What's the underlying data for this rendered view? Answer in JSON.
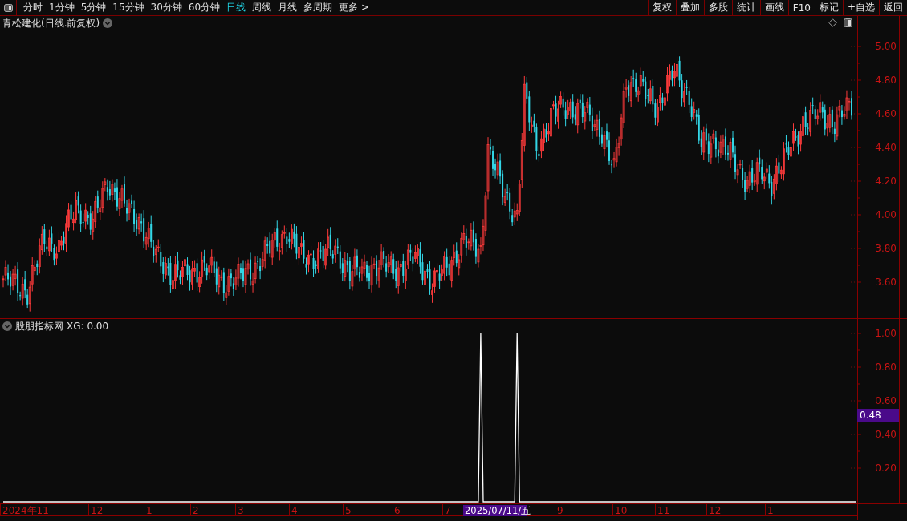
{
  "toolbar": {
    "periods": [
      {
        "label": "分时",
        "selected": false
      },
      {
        "label": "1分钟",
        "selected": false
      },
      {
        "label": "5分钟",
        "selected": false
      },
      {
        "label": "15分钟",
        "selected": false
      },
      {
        "label": "30分钟",
        "selected": false
      },
      {
        "label": "60分钟",
        "selected": false
      },
      {
        "label": "日线",
        "selected": true
      },
      {
        "label": "周线",
        "selected": false
      },
      {
        "label": "月线",
        "selected": false
      },
      {
        "label": "多周期",
        "selected": false
      },
      {
        "label": "更多 >",
        "selected": false
      }
    ],
    "buttons": [
      "复权",
      "叠加",
      "多股",
      "统计",
      "画线",
      "F10",
      "标记",
      "+自选",
      "返回"
    ]
  },
  "price_panel": {
    "title": "青松建化(日线.前复权)",
    "axis_labels": [
      "5.00",
      "4.80",
      "4.60",
      "4.40",
      "4.20",
      "4.00",
      "3.80",
      "3.60"
    ]
  },
  "indicator_panel": {
    "title": "股朋指标网",
    "reading": "XG: 0.00",
    "cursor_value": "0.48",
    "axis_labels": [
      "1.00",
      "0.80",
      "0.60",
      "0.40",
      "0.20"
    ]
  },
  "date_axis": {
    "labels": [
      "2024年11",
      "12",
      "1",
      "2",
      "3",
      "4",
      "5",
      "6",
      "7",
      "9",
      "10",
      "11",
      "12",
      "1"
    ],
    "cursor_date": "2025/07/11/五"
  }
}
